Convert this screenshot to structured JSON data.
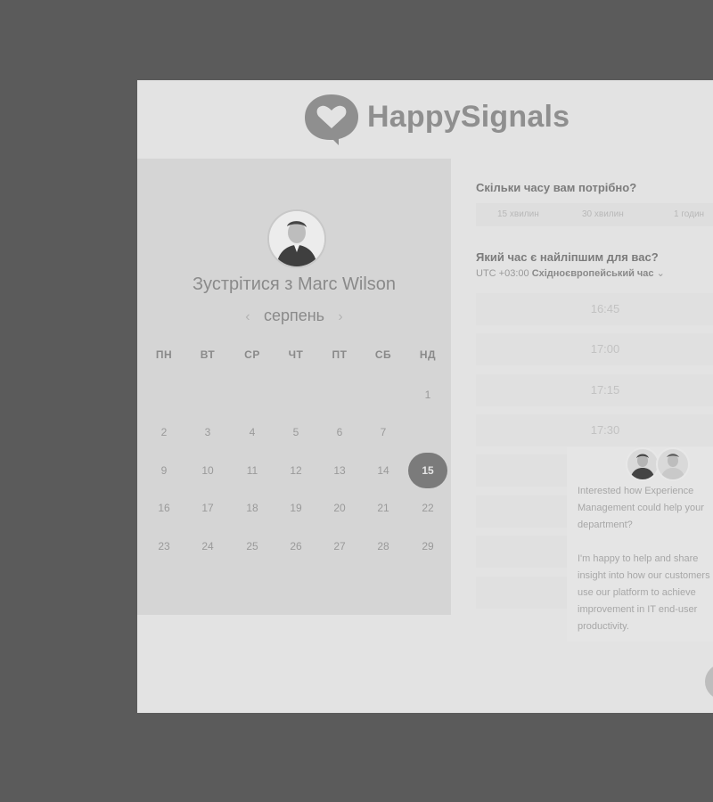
{
  "brand": {
    "name": "HappySignals",
    "logo_icon": "heart-speech-bubble-icon"
  },
  "colors": {
    "overlay": "#5b5b5b",
    "selected_day": "#7b7b7b",
    "panel": "#d5d5d5"
  },
  "calendar": {
    "title": "Зустрітися з Marc Wilson",
    "month": "серпень",
    "prev_icon": "chevron-left-icon",
    "next_icon": "chevron-right-icon",
    "weekdays": [
      "ПН",
      "ВТ",
      "СР",
      "ЧТ",
      "ПТ",
      "СБ",
      "НД"
    ],
    "weeks": [
      [
        "",
        "",
        "",
        "",
        "",
        "",
        "1"
      ],
      [
        "2",
        "3",
        "4",
        "5",
        "6",
        "7",
        ""
      ],
      [
        "9",
        "10",
        "11",
        "12",
        "13",
        "14",
        "15"
      ],
      [
        "16",
        "17",
        "18",
        "19",
        "20",
        "21",
        "22"
      ],
      [
        "23",
        "24",
        "25",
        "26",
        "27",
        "28",
        "29"
      ]
    ],
    "selected_day": "15"
  },
  "booking": {
    "duration_question": "Скільки часу вам потрібно?",
    "durations": [
      "15 хвилин",
      "30 хвилин",
      "1 годин"
    ],
    "time_question": "Який час є найліпшим для вас?",
    "timezone_offset": "UTC +03:00",
    "timezone_name": "Східноєвропейський час",
    "timezone_caret": "⌄",
    "slots": [
      "16:45",
      "17:00",
      "17:15",
      "17:30",
      "",
      "",
      "",
      ""
    ]
  },
  "chat": {
    "message1": "Interested how Experience Management could help your department?",
    "message2": "I'm happy to help and share insight into how our customers use our platform to achieve improvement in IT end-user productivity."
  }
}
